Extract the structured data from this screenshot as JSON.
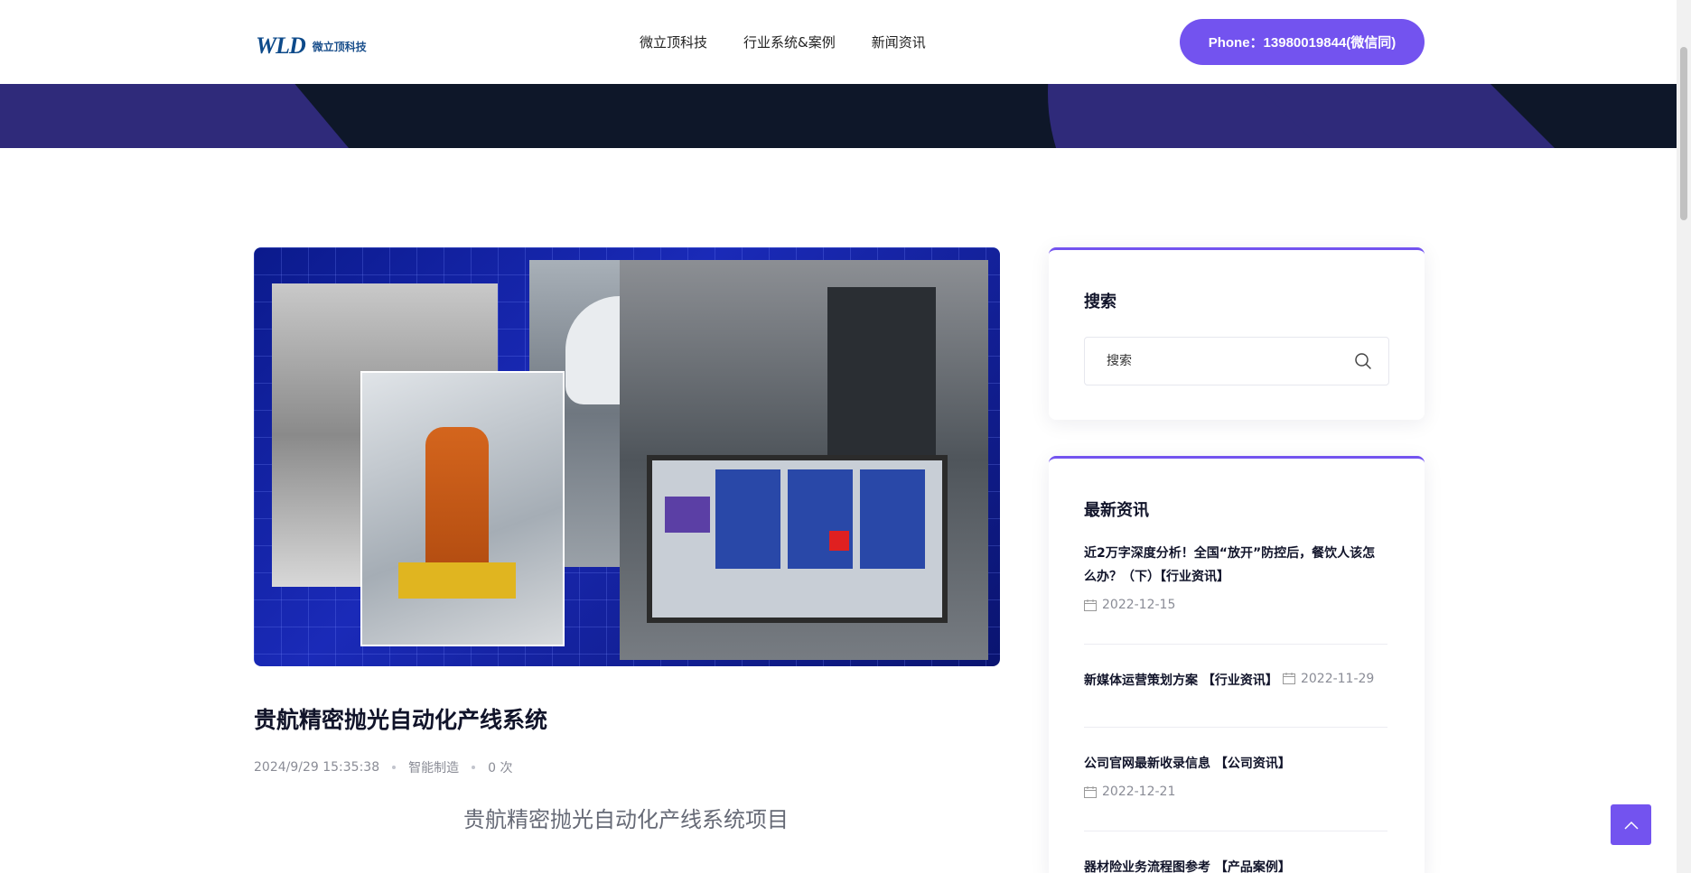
{
  "header": {
    "logo_mark": "WLD",
    "logo_text": "微立顶科技",
    "nav": [
      "微立顶科技",
      "行业系统&案例",
      "新闻资讯"
    ],
    "phone_label": "Phone：13980019844(微信同)"
  },
  "article": {
    "title": "贵航精密抛光自动化产线系统",
    "datetime": "2024/9/29 15:35:38",
    "category": "智能制造",
    "views": "0 次",
    "subtitle": "贵航精密抛光自动化产线系统项目"
  },
  "sidebar": {
    "search_title": "搜索",
    "search_placeholder": "搜索",
    "news_title": "最新资讯",
    "news": [
      {
        "title": "近2万字深度分析！全国“放开”防控后，餐饮人该怎么办？（下）【行业资讯】",
        "date": "2022-12-15"
      },
      {
        "title": "新媒体运营策划方案 【行业资讯】",
        "date": "2022-11-29"
      },
      {
        "title": "公司官网最新收录信息 【公司资讯】",
        "date": "2022-12-21"
      },
      {
        "title": "器材险业务流程图参考 【产品案例】",
        "date": ""
      }
    ]
  },
  "colors": {
    "accent": "#7353ef",
    "banner": "#0e1729",
    "banner_shape": "#2f2a7a"
  },
  "icons": {
    "search": "search-icon",
    "calendar": "calendar-icon",
    "back_to_top": "chevron-up-icon"
  }
}
